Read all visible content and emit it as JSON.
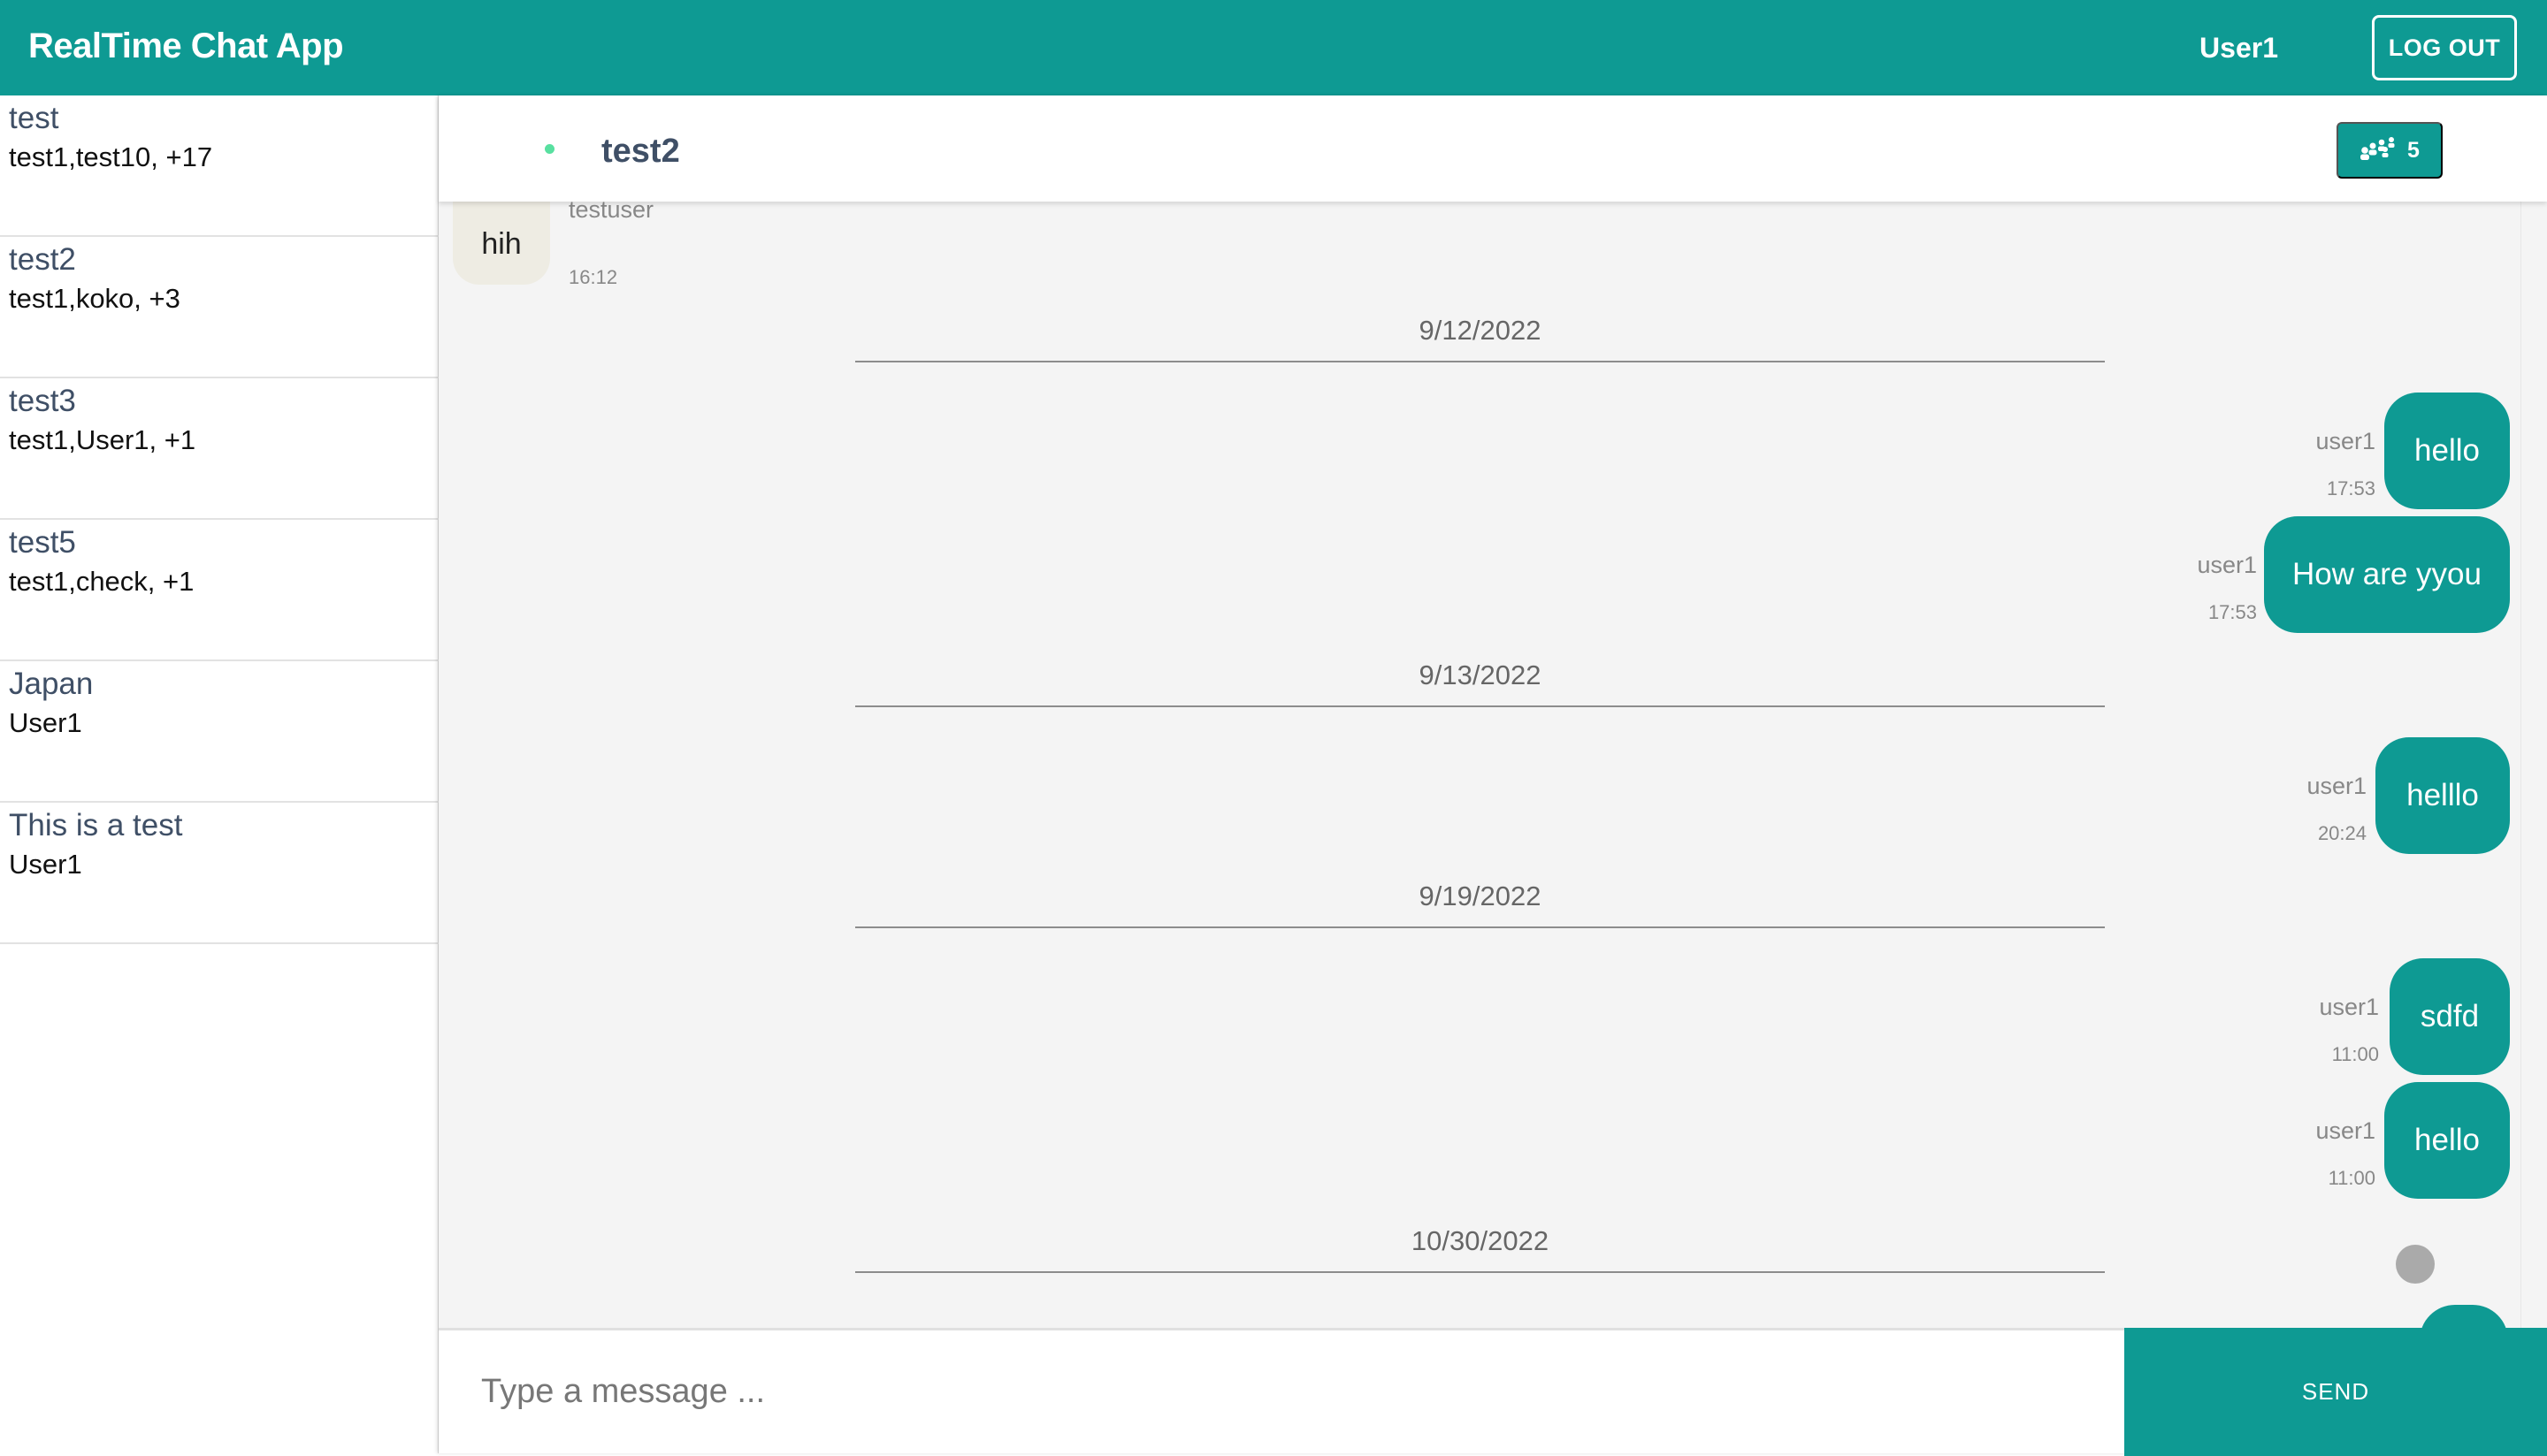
{
  "app": {
    "title": "RealTime Chat App",
    "current_user": "User1",
    "logout_label": "LOG OUT"
  },
  "rooms": [
    {
      "name": "test",
      "members": "test1,test10, +17"
    },
    {
      "name": "test2",
      "members": "test1,koko, +3"
    },
    {
      "name": "test3",
      "members": "test1,User1, +1"
    },
    {
      "name": "test5",
      "members": "test1,check, +1"
    },
    {
      "name": "Japan",
      "members": "User1"
    },
    {
      "name": "This is a test",
      "members": "User1"
    }
  ],
  "chat": {
    "room_title": "test2",
    "member_count": "5",
    "incoming": {
      "text": "hih",
      "sender": "testuser",
      "time": "16:12"
    },
    "date_separators": [
      "9/12/2022",
      "9/13/2022",
      "9/19/2022",
      "10/30/2022"
    ],
    "outgoing": [
      {
        "text": "hello",
        "sender": "user1",
        "time": "17:53"
      },
      {
        "text": "How are yyou",
        "sender": "user1",
        "time": "17:53"
      },
      {
        "text": "helllo",
        "sender": "user1",
        "time": "20:24"
      },
      {
        "text": "sdfd",
        "sender": "user1",
        "time": "11:00"
      },
      {
        "text": "hello",
        "sender": "user1",
        "time": "11:00"
      }
    ],
    "composer": {
      "placeholder": "Type a message ...",
      "value": "",
      "send_label": "SEND"
    }
  },
  "colors": {
    "primary": "#0e9a93",
    "online": "#58e0a0",
    "incoming_bubble": "#eeece3"
  },
  "icons": {
    "members": "group-icon",
    "online": "online-status-dot"
  }
}
